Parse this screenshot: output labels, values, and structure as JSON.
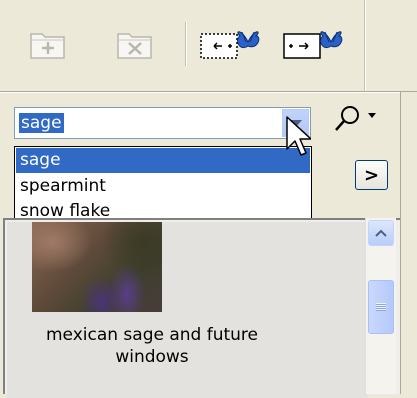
{
  "toolbar": {
    "buttons": [
      {
        "name": "new-folder-icon",
        "enabled": false
      },
      {
        "name": "delete-folder-icon",
        "enabled": false
      },
      {
        "name": "select-area-left-icon",
        "enabled": true
      },
      {
        "name": "select-area-right-icon",
        "enabled": true
      }
    ]
  },
  "combo": {
    "value": "sage",
    "options": [
      "sage",
      "spearmint",
      "snow flake"
    ],
    "selected_index": 0
  },
  "search": {
    "icon": "magnifier-icon"
  },
  "go_button": {
    "label": ">"
  },
  "thumbnail": {
    "caption_line1": "mexican sage and future",
    "caption_line2": "windows"
  },
  "colors": {
    "selection": "#316ac5",
    "chrome": "#ece9d8"
  }
}
